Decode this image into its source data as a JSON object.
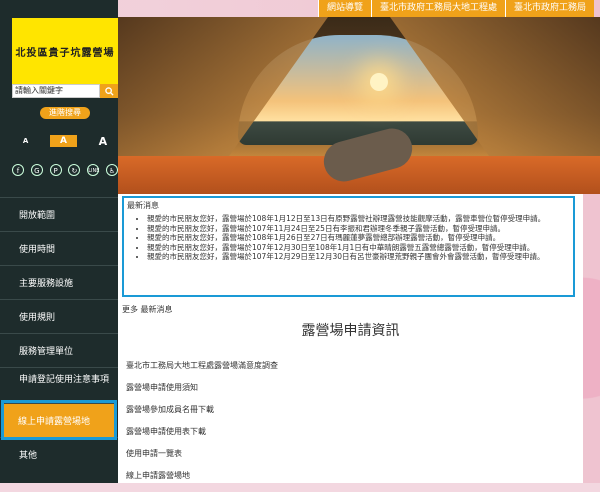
{
  "topnav": [
    "網站導覽",
    "臺北市政府工務局大地工程處",
    "臺北市政府工務局"
  ],
  "logo_text": "北投區貴子坑露營場",
  "search": {
    "placeholder": "請輸入關鍵字"
  },
  "advanced_search": "進階搜尋",
  "font_sizes": [
    "A",
    "A",
    "A"
  ],
  "social": [
    "f",
    "G",
    "P",
    "↻",
    "LINE",
    "♿"
  ],
  "nav": [
    "開放範圍",
    "使用時間",
    "主要服務設施",
    "使用規則",
    "服務管理單位",
    "申請登記使用注意事項",
    "線上申請露營場地",
    "其他"
  ],
  "news": {
    "title": "最新消息",
    "items": [
      "親愛的市民朋友您好，露營場於108年1月12日至13日有原野露營社辦理露營技能觀摩活動，露營車營位暫停受理申請。",
      "親愛的市民朋友您好，露營場於107年11月24日至25日有李振和君辦理冬季親子露營活動，暫停受理申請。",
      "親愛的市民朋友您好，露營場於108年1月26日至27日有瑪麗蓮夢露營總部辦理露營活動，暫停受理申請。",
      "親愛的市民朋友您好，露營場於107年12月30日至108年1月1日有中華晴朗露營五露營總露營活動，暫停受理申請。",
      "親愛的市民朋友您好，露營場於107年12月29日至12月30日有呂世豪辦理荒野親子團會外會露營活動，暫停受理申請。"
    ],
    "more": "更多 最新消息"
  },
  "page_title": "露營場申請資訊",
  "links": [
    "臺北市工務局大地工程處露營場滿意度調查",
    "露營場申請使用須知",
    "露營場參加成員名冊下載",
    "露營場申請使用表下載",
    "使用申請一覽表",
    "線上申請露營場地"
  ]
}
